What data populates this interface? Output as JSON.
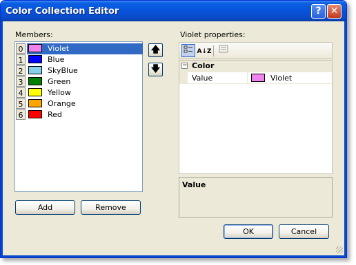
{
  "window": {
    "title": "Color Collection Editor",
    "help_glyph": "?",
    "close_glyph": "✕"
  },
  "members": {
    "label": "Members:",
    "items": [
      {
        "index": "0",
        "name": "Violet",
        "color": "#ee82ee",
        "selected": true
      },
      {
        "index": "1",
        "name": "Blue",
        "color": "#0000ff"
      },
      {
        "index": "2",
        "name": "SkyBlue",
        "color": "#87ceeb"
      },
      {
        "index": "3",
        "name": "Green",
        "color": "#008000"
      },
      {
        "index": "4",
        "name": "Yellow",
        "color": "#ffff00"
      },
      {
        "index": "5",
        "name": "Orange",
        "color": "#ffa500"
      },
      {
        "index": "6",
        "name": "Red",
        "color": "#ff0000"
      }
    ],
    "move_up_glyph": "🡅",
    "move_down_glyph": "🡇",
    "add_label": "Add",
    "remove_label": "Remove"
  },
  "properties": {
    "label": "Violet properties:",
    "toolbar": {
      "categorized_icon": "categorized-icon",
      "alphabetical_glyph": "A↓Z",
      "property_pages_icon": "property-pages-icon"
    },
    "category": {
      "toggle": "−",
      "name": "Color"
    },
    "rows": [
      {
        "name": "Value",
        "value": "Violet",
        "color": "#ee82ee"
      }
    ],
    "description_title": "Value"
  },
  "footer": {
    "ok_label": "OK",
    "cancel_label": "Cancel"
  }
}
